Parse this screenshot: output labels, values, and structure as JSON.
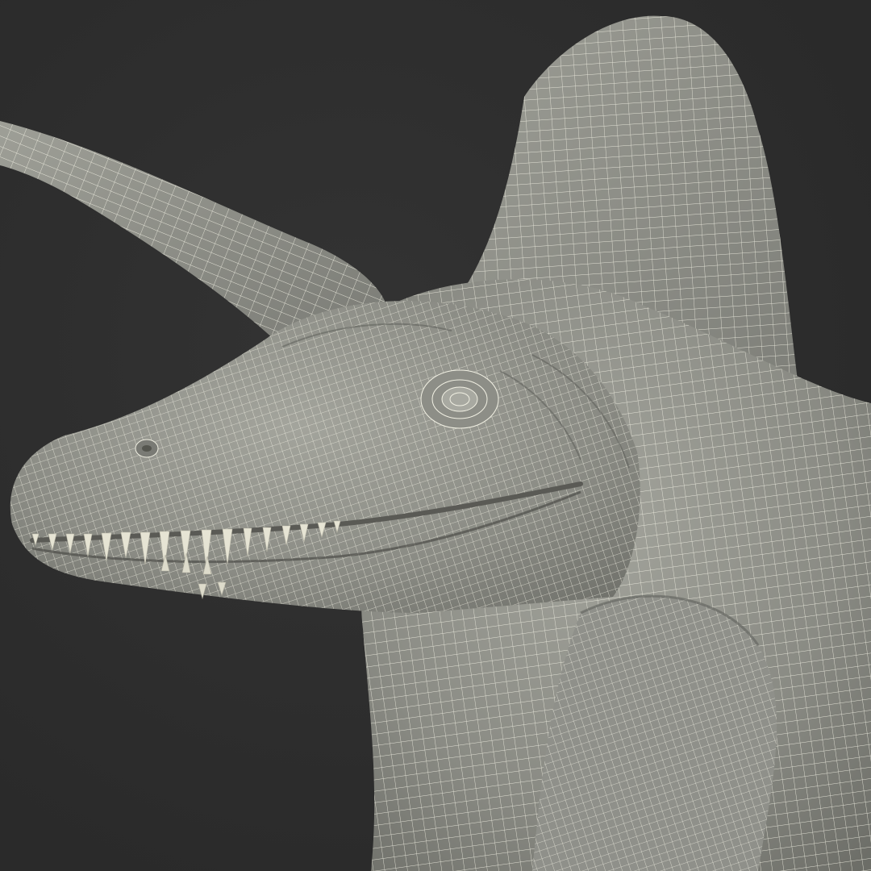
{
  "scene": {
    "subject": "spinosaurus-wireframe-model",
    "colors": {
      "background": "#2d2d2d",
      "mesh_fill": "#8a8b84",
      "mesh_fill_light": "#a3a49c",
      "mesh_fill_dark": "#6c6d67",
      "wire": "#f2f1e4",
      "teeth": "#e6e4d4",
      "mouth": "#5a5a55"
    }
  }
}
